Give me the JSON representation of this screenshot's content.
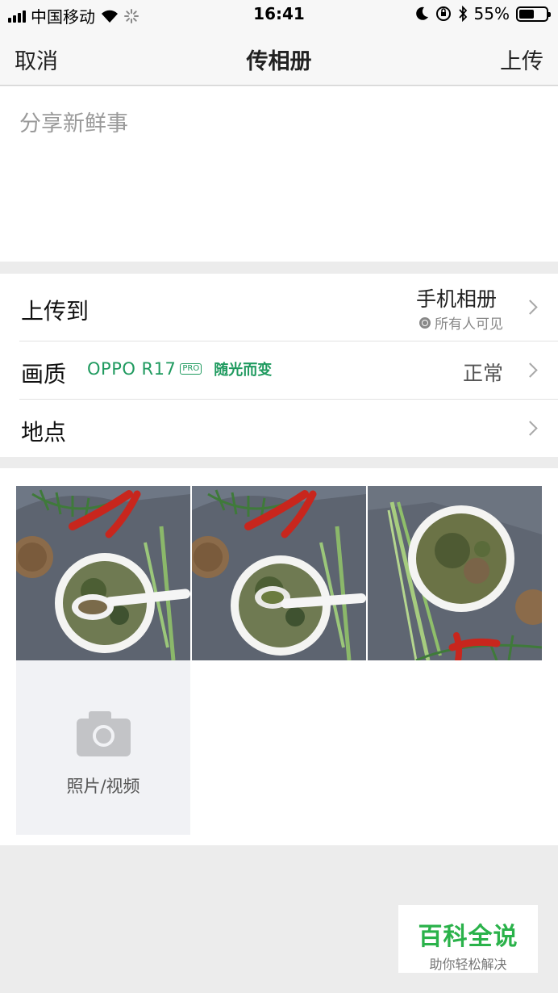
{
  "status_bar": {
    "carrier": "中国移动",
    "time": "16:41",
    "battery": "55%",
    "battery_level": 0.55
  },
  "nav": {
    "cancel_label": "取消",
    "title": "传相册",
    "upload_label": "上传"
  },
  "compose": {
    "placeholder": "分享新鲜事",
    "value": ""
  },
  "settings": {
    "upload_to": {
      "label": "上传到",
      "album": "手机相册",
      "privacy": "所有人可见"
    },
    "quality": {
      "label": "画质",
      "value": "正常",
      "ad_brand": "OPPO R17",
      "ad_pro": "PRO",
      "ad_slogan": "随光而变"
    },
    "location": {
      "label": "地点"
    }
  },
  "media": {
    "photos": [
      "soup-with-spoon-photo-1",
      "soup-with-spoon-photo-2",
      "soup-bowl-photo-3"
    ],
    "add_label": "照片/视频"
  },
  "watermark": {
    "title": "百科全说",
    "subtitle": "助你轻松解决"
  },
  "colors": {
    "accent_green": "#1f9a5f",
    "watermark_green": "#2ab24a",
    "background": "#ececec"
  }
}
